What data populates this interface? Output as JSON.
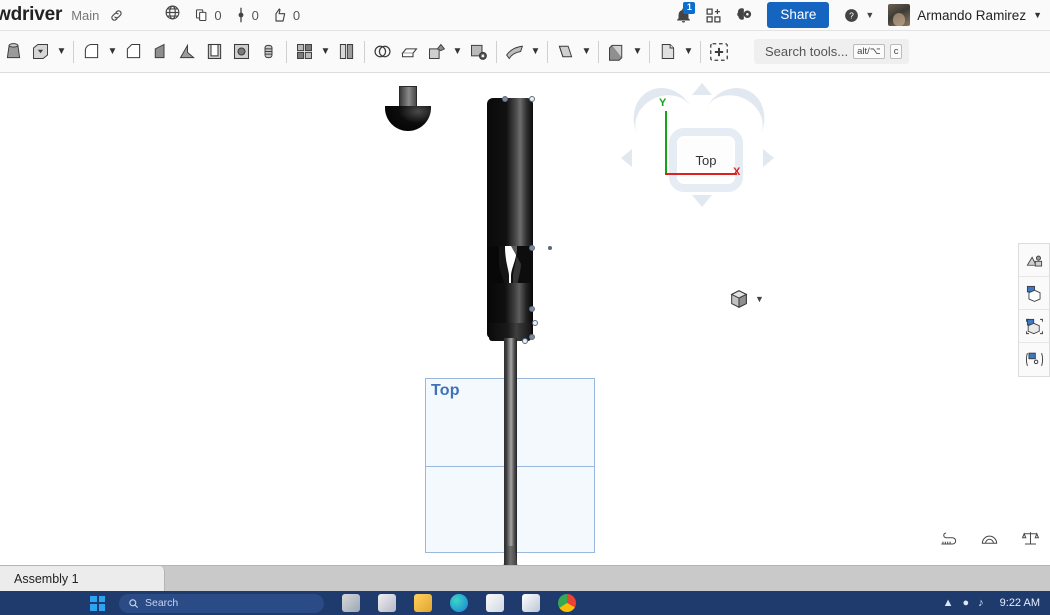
{
  "topbar": {
    "document_title": "wdriver",
    "branch": "Main",
    "link_icon": "link-icon",
    "visibility_icon": "globe-public-icon",
    "copies_icon": "copy-icon",
    "copies_count": "0",
    "versions_icon": "branch-icon",
    "versions_count": "0",
    "likes_icon": "thumbs-up-icon",
    "likes_count": "0",
    "notifications_icon": "bell-icon",
    "notifications_badge": "1",
    "apps_icon": "apps-grid-plus-icon",
    "ai_icon": "brain-assistant-icon",
    "share_label": "Share",
    "help_icon": "help-circle-icon",
    "user_name": "Armando Ramirez",
    "avatar_name": "user-avatar"
  },
  "toolbar": {
    "groups": [
      {
        "items": [
          {
            "name": "revolve-tool",
            "icon": "revolve-icon",
            "caret": false
          },
          {
            "name": "extrude-tool",
            "icon": "extrude-icon",
            "caret": true
          }
        ]
      },
      {
        "items": [
          {
            "name": "fillet-tool",
            "icon": "fillet-icon",
            "caret": true
          },
          {
            "name": "chamfer-tool",
            "icon": "chamfer-icon",
            "caret": false
          },
          {
            "name": "draft-tool",
            "icon": "draft-icon",
            "caret": false
          },
          {
            "name": "rib-tool",
            "icon": "rib-icon",
            "caret": false
          },
          {
            "name": "shell-tool",
            "icon": "shell-icon",
            "caret": false
          },
          {
            "name": "hole-tool",
            "icon": "hole-icon",
            "caret": false
          },
          {
            "name": "thread-tool",
            "icon": "thread-icon",
            "caret": false
          }
        ]
      },
      {
        "items": [
          {
            "name": "pattern-tool",
            "icon": "pattern-grid-icon",
            "caret": true
          },
          {
            "name": "mirror-tool",
            "icon": "mirror-icon",
            "caret": false
          }
        ]
      },
      {
        "items": [
          {
            "name": "boolean-tool",
            "icon": "boolean-union-icon",
            "caret": false
          },
          {
            "name": "split-tool",
            "icon": "split-icon",
            "caret": false
          },
          {
            "name": "transform-tool",
            "icon": "transform-icon",
            "caret": true
          },
          {
            "name": "delete-part-tool",
            "icon": "delete-part-icon",
            "caret": false
          }
        ]
      },
      {
        "items": [
          {
            "name": "sheet-metal-tool",
            "icon": "sheet-metal-icon",
            "caret": true
          }
        ]
      },
      {
        "items": [
          {
            "name": "surface-tool",
            "icon": "surface-icon",
            "caret": true
          }
        ]
      },
      {
        "items": [
          {
            "name": "derive-tool",
            "icon": "derive-icon",
            "caret": true
          }
        ]
      },
      {
        "items": [
          {
            "name": "variable-tool",
            "icon": "variable-icon",
            "caret": true
          }
        ]
      },
      {
        "items": [
          {
            "name": "insert-feature-tool",
            "icon": "add-dashed-box-icon",
            "caret": false
          }
        ]
      }
    ],
    "search_placeholder": "Search tools...",
    "search_kbd_1": "alt/⌥",
    "search_kbd_2": "c"
  },
  "canvas": {
    "plane_label": "Top",
    "origin_point_name": "sketch-origin-point",
    "part_name": "screwdriver-body",
    "floating_part_name": "screwdriver-cap-part",
    "viewcube": {
      "face_label": "Top",
      "axis_y_label": "Y",
      "axis_x_label": "X",
      "axis_y_color": "#16a416",
      "axis_x_color": "#e02020",
      "view_mode_icon": "shaded-cube-icon"
    },
    "right_rail": [
      {
        "name": "rail-appearance",
        "icon": "appearance-icon"
      },
      {
        "name": "rail-mesh",
        "icon": "mesh-cube-icon"
      },
      {
        "name": "rail-section",
        "icon": "section-cube-icon"
      },
      {
        "name": "rail-explode",
        "icon": "explode-icon"
      }
    ],
    "measure_tools": [
      {
        "name": "measure-length-tool",
        "icon": "tape-measure-icon"
      },
      {
        "name": "measure-angle-tool",
        "icon": "protractor-icon"
      },
      {
        "name": "mass-properties-tool",
        "icon": "scale-balance-icon"
      }
    ]
  },
  "tabbar": {
    "active_tab": "Assembly 1"
  },
  "taskbar": {
    "start_icon": "windows-start-icon",
    "search_placeholder": "Search",
    "apps": [
      {
        "name": "taskview-icon"
      },
      {
        "name": "mail-icon"
      },
      {
        "name": "file-explorer-icon"
      },
      {
        "name": "edge-browser-icon"
      },
      {
        "name": "microsoft-store-icon"
      },
      {
        "name": "photos-icon"
      },
      {
        "name": "chrome-browser-icon"
      }
    ],
    "clock": "9:22 AM"
  }
}
